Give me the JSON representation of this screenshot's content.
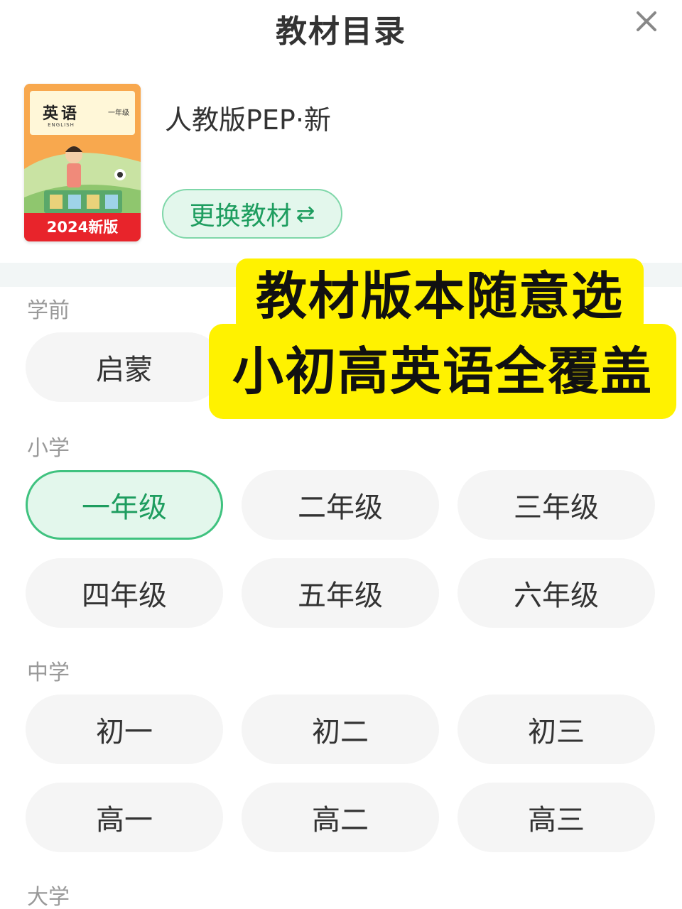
{
  "header": {
    "title": "教材目录",
    "close_icon": "close-icon"
  },
  "book": {
    "cover_title": "英语",
    "cover_subtitle": "ENGLISH",
    "cover_grade": "一年级",
    "cover_badge": "2024新版",
    "name": "人教版PEP·新",
    "switch_label": "更换教材",
    "switch_icon": "⇄"
  },
  "promo": {
    "line1": "教材版本随意选",
    "line2": "小初高英语全覆盖",
    "background": "#fff200"
  },
  "sections": {
    "preschool": {
      "label": "学前",
      "items": [
        "启蒙"
      ]
    },
    "primary": {
      "label": "小学",
      "items": [
        "一年级",
        "二年级",
        "三年级",
        "四年级",
        "五年级",
        "六年级"
      ],
      "selected": "一年级"
    },
    "secondary": {
      "label": "中学",
      "items": [
        "初一",
        "初二",
        "初三",
        "高一",
        "高二",
        "高三"
      ]
    },
    "university": {
      "label": "大学"
    }
  },
  "colors": {
    "accent": "#3fc27f",
    "accent_bg": "#e3f7ec",
    "accent_text": "#1e9d5f",
    "pill_bg": "#f5f5f5",
    "label": "#999999"
  }
}
